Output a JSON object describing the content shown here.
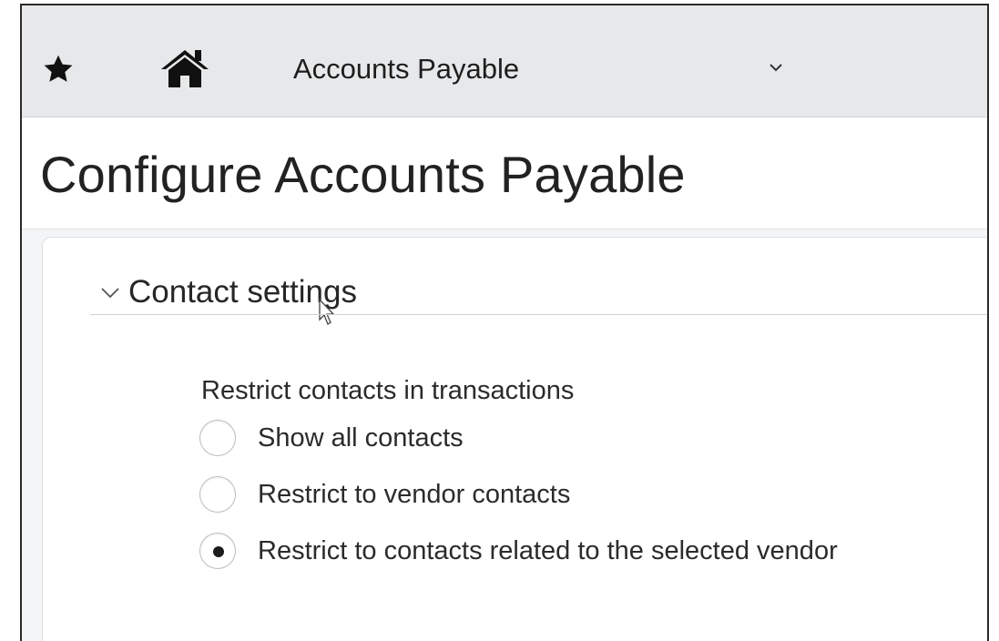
{
  "topbar": {
    "favorites_icon": "star-icon",
    "home_icon": "home-icon",
    "module_label": "Accounts Payable",
    "module_dropdown_icon": "chevron-down-icon"
  },
  "page": {
    "title": "Configure Accounts Payable"
  },
  "section": {
    "title": "Contact settings",
    "expanded": true
  },
  "field": {
    "label": "Restrict contacts in transactions",
    "options": [
      {
        "label": "Show all contacts",
        "selected": false
      },
      {
        "label": "Restrict to vendor contacts",
        "selected": false
      },
      {
        "label": "Restrict to contacts related to the selected vendor",
        "selected": true
      }
    ]
  },
  "colors": {
    "topbar_bg": "#e6e8ea",
    "text": "#222222",
    "radio_border": "#b9bdc2"
  }
}
